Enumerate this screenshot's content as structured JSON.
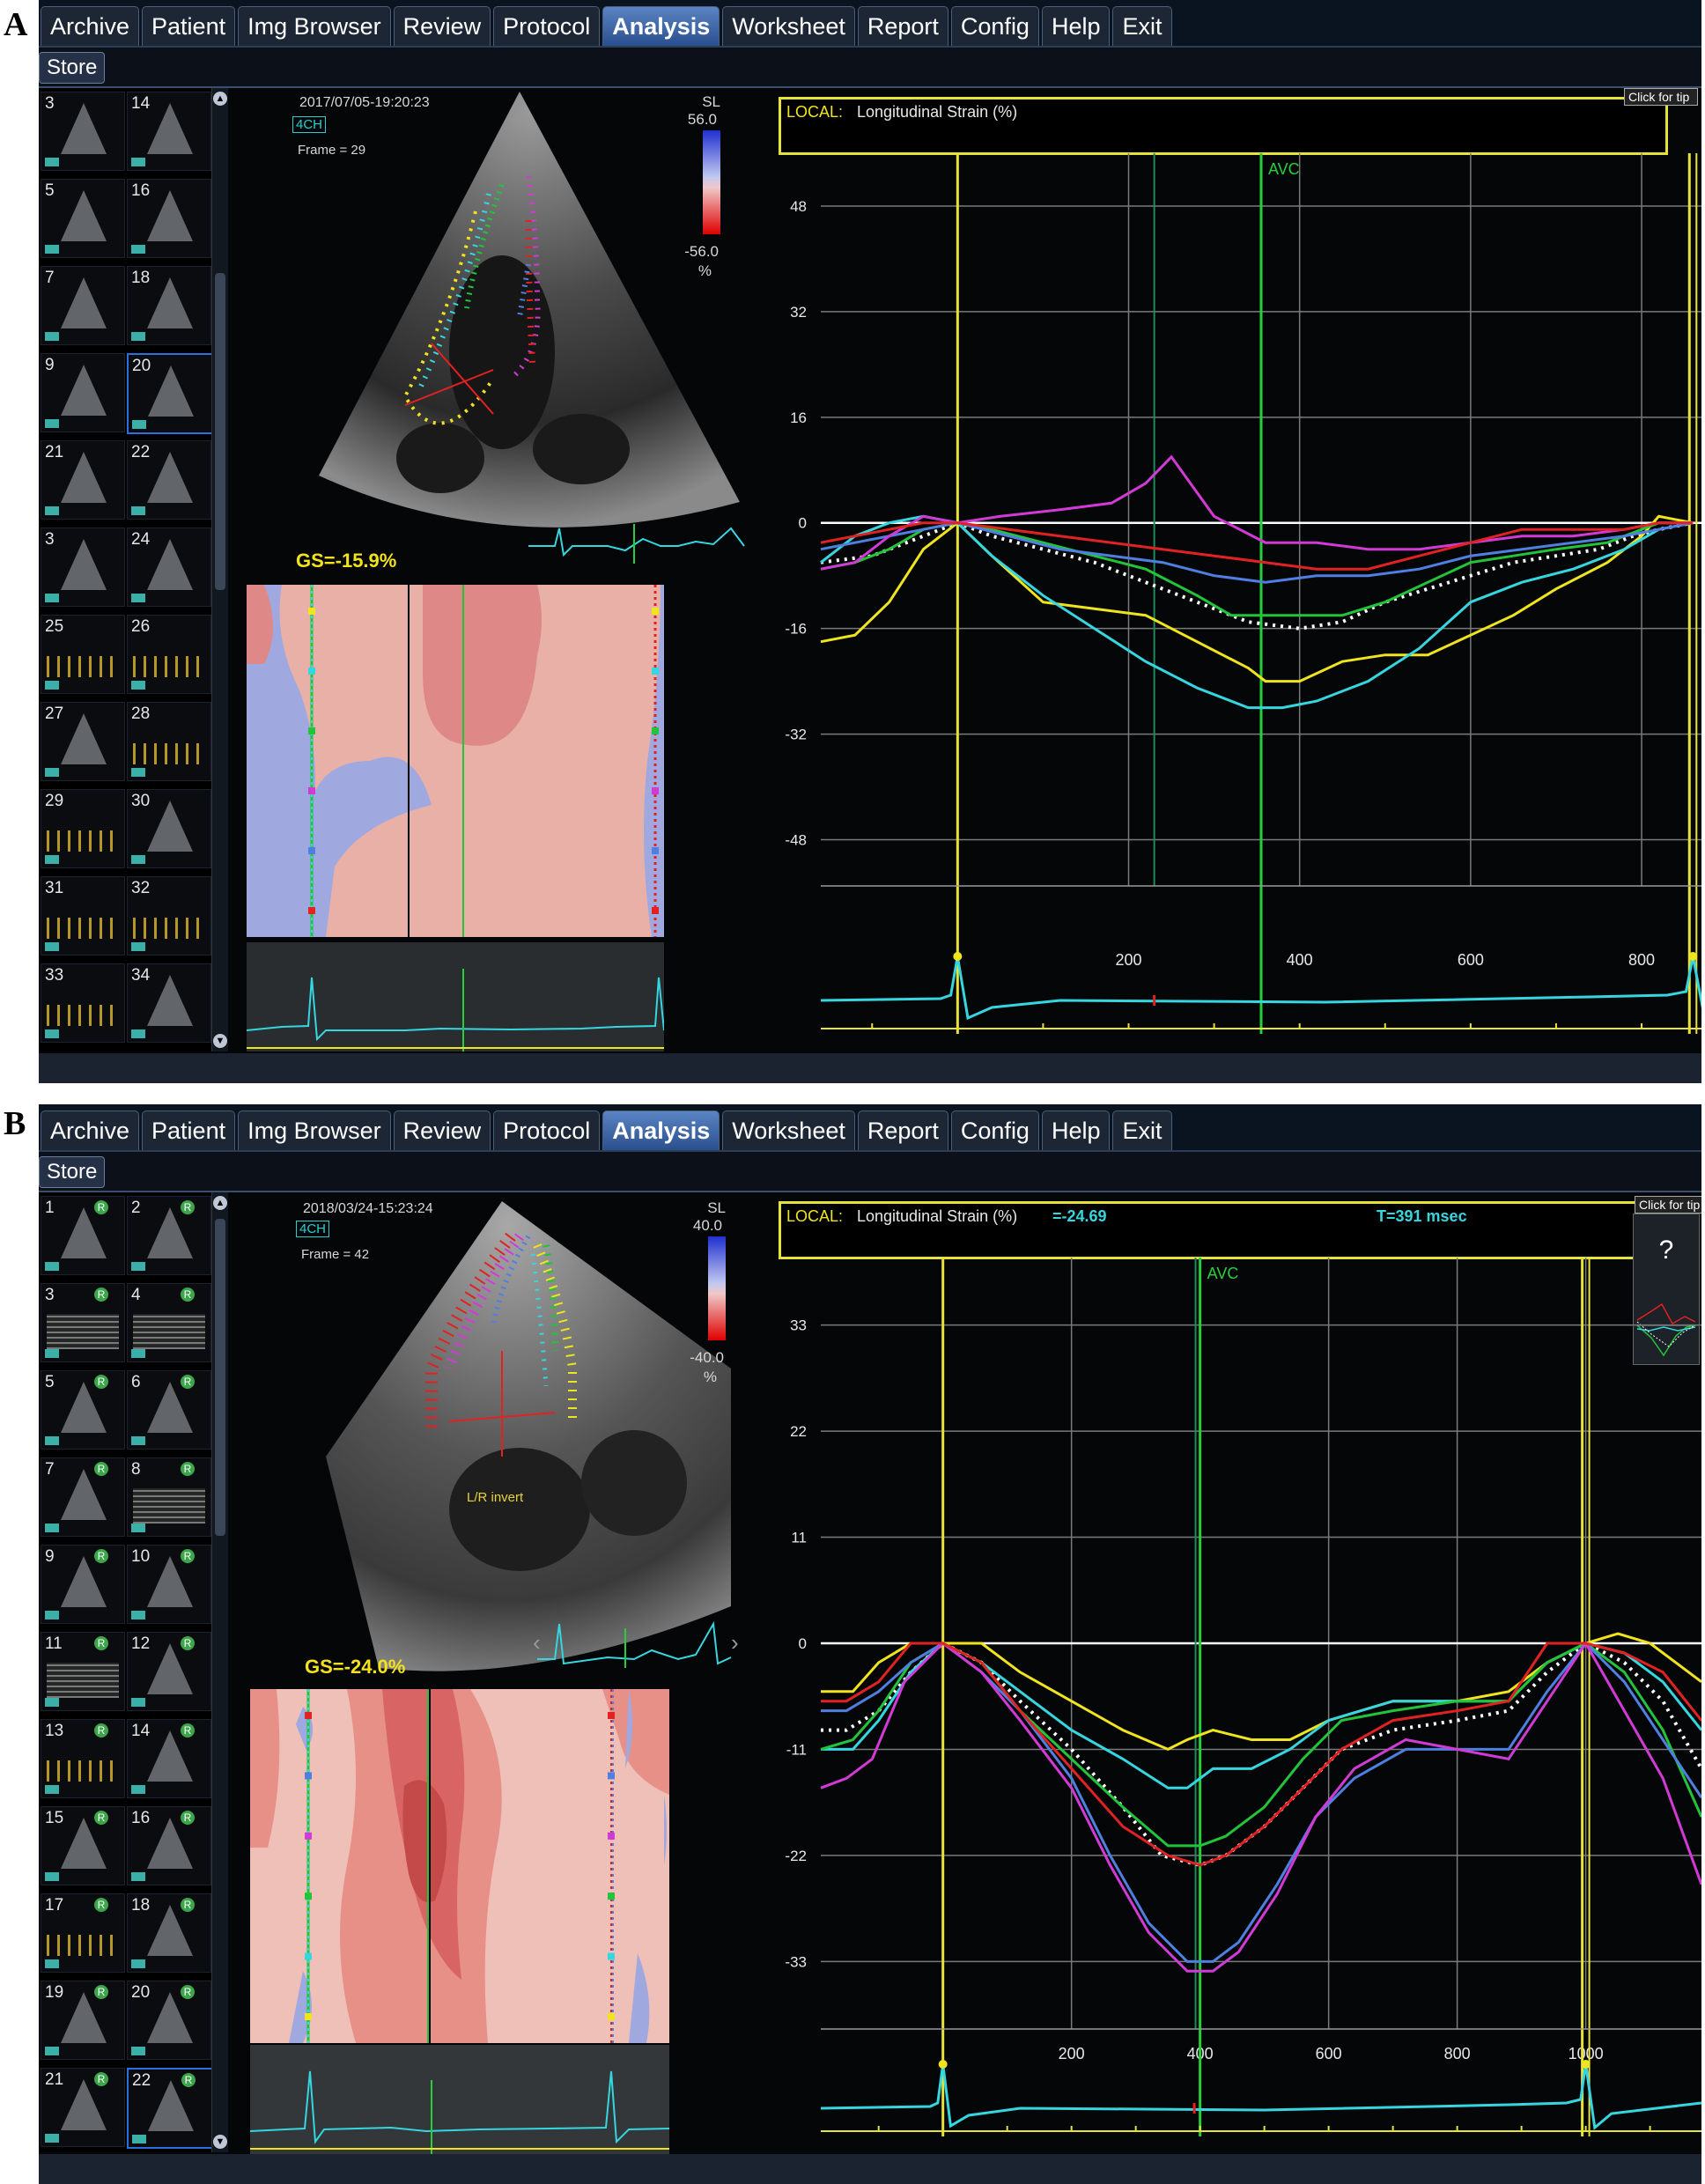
{
  "figure": {
    "panel_a_label": "A",
    "panel_b_label": "B"
  },
  "menu": {
    "items": [
      "Archive",
      "Patient",
      "Img Browser",
      "Review",
      "Protocol",
      "Analysis",
      "Worksheet",
      "Report",
      "Config",
      "Help",
      "Exit"
    ],
    "active": "Analysis",
    "store_label": "Store"
  },
  "colors": {
    "accent_yellow": "#e6e23a",
    "trace_cyan": "#35d6e0",
    "avc_green": "#25d03c",
    "segment_colors": [
      "#ffffff",
      "#f0e41e",
      "#35d6e0",
      "#22c43a",
      "#4f7fe0",
      "#d23ad6",
      "#e02222"
    ]
  },
  "panel_a": {
    "thumbnails": [
      "3",
      "14",
      "5",
      "16",
      "7",
      "18",
      "9",
      "20",
      "21",
      "22",
      "3",
      "24",
      "25",
      "26",
      "27",
      "28",
      "29",
      "30",
      "31",
      "32",
      "33",
      "34"
    ],
    "selected_thumbnail": "20",
    "echo": {
      "timestamp": "2017/07/05-19:20:23",
      "view": "4CH",
      "frame": "Frame = 29",
      "scale_title": "SL",
      "scale_max": "56.0",
      "scale_min": "-56.0",
      "scale_unit": "%",
      "gs": "GS=-15.9%"
    },
    "chart": {
      "local_label": "LOCAL:",
      "title": "Longitudinal Strain (%)",
      "button": "Click for tip",
      "avc_label": "AVC"
    }
  },
  "panel_b": {
    "thumbnails": [
      "1",
      "2",
      "3",
      "4",
      "5",
      "6",
      "7",
      "8",
      "9",
      "10",
      "11",
      "12",
      "13",
      "14",
      "15",
      "16",
      "17",
      "18",
      "19",
      "20",
      "21",
      "22"
    ],
    "selected_thumbnail": "22",
    "echo": {
      "timestamp": "2018/03/24-15:23:24",
      "view": "4CH",
      "frame": "Frame = 42",
      "scale_title": "SL",
      "scale_max": "40.0",
      "scale_min": "-40.0",
      "scale_unit": "%",
      "gs": "GS=-24.0%",
      "lr_invert": "L/R invert"
    },
    "chart": {
      "local_label": "LOCAL:",
      "title": "Longitudinal Strain (%)",
      "value": "=-24.69",
      "time": "T=391 msec",
      "button": "Click for tip",
      "inset_symbol": "?",
      "avc_label": "AVC"
    }
  },
  "chart_data": [
    {
      "type": "line",
      "title": "Longitudinal Strain (%)",
      "xlabel": "",
      "ylabel": "",
      "x_ticks": [
        200,
        400,
        600,
        800
      ],
      "y_ticks": [
        48,
        32,
        16,
        0,
        -16,
        -32,
        -48
      ],
      "xlim": [
        -160,
        870
      ],
      "ylim": [
        -55,
        56
      ],
      "grid": true,
      "markers": {
        "start_ms": 0,
        "end_ms": 860,
        "avc_ms": 355
      },
      "series": [
        {
          "color": "#ffffff",
          "style": "dotted",
          "x": [
            -160,
            -100,
            -60,
            -20,
            0,
            40,
            100,
            160,
            220,
            280,
            340,
            400,
            450,
            500,
            550,
            600,
            650,
            700,
            750,
            790,
            820,
            860
          ],
          "y": [
            -6,
            -5,
            -3,
            -1,
            0,
            -2,
            -4,
            -6,
            -9,
            -12,
            -15,
            -16,
            -15,
            -12,
            -10,
            -8,
            -6,
            -5,
            -4,
            -2,
            -1,
            0
          ]
        },
        {
          "color": "#f0e41e",
          "x": [
            -160,
            -120,
            -80,
            -40,
            0,
            40,
            100,
            160,
            220,
            280,
            340,
            360,
            400,
            450,
            500,
            550,
            600,
            650,
            700,
            760,
            800,
            820,
            860
          ],
          "y": [
            -18,
            -17,
            -12,
            -4,
            0,
            -5,
            -12,
            -13,
            -14,
            -18,
            -22,
            -24,
            -24,
            -21,
            -20,
            -20,
            -17,
            -14,
            -10,
            -6,
            -2,
            1,
            0
          ]
        },
        {
          "color": "#35d6e0",
          "x": [
            -160,
            -120,
            -80,
            -40,
            0,
            40,
            100,
            160,
            220,
            280,
            340,
            380,
            420,
            480,
            540,
            600,
            660,
            720,
            780,
            820,
            860
          ],
          "y": [
            -6,
            -2,
            0,
            1,
            0,
            -5,
            -11,
            -16,
            -21,
            -25,
            -28,
            -28,
            -27,
            -24,
            -19,
            -12,
            -9,
            -7,
            -4,
            -1,
            0
          ]
        },
        {
          "color": "#22c43a",
          "x": [
            -160,
            -120,
            -80,
            -40,
            0,
            40,
            100,
            160,
            220,
            280,
            320,
            360,
            400,
            450,
            500,
            550,
            600,
            650,
            700,
            760,
            800,
            820,
            860
          ],
          "y": [
            -7,
            -6,
            -4,
            -1,
            0,
            -1,
            -3,
            -5,
            -7,
            -11,
            -14,
            -14,
            -14,
            -14,
            -12,
            -9,
            -6,
            -5,
            -4,
            -3,
            -1,
            0,
            0
          ]
        },
        {
          "color": "#4f7fe0",
          "x": [
            -160,
            -120,
            -80,
            -40,
            0,
            60,
            120,
            180,
            240,
            300,
            360,
            420,
            480,
            540,
            600,
            660,
            720,
            780,
            820,
            860
          ],
          "y": [
            -4,
            -3,
            -2,
            -1,
            0,
            -2,
            -4,
            -5,
            -6,
            -8,
            -9,
            -8,
            -8,
            -7,
            -5,
            -4,
            -3,
            -2,
            -1,
            0
          ]
        },
        {
          "color": "#d23ad6",
          "x": [
            -160,
            -120,
            -80,
            -40,
            0,
            50,
            120,
            180,
            220,
            250,
            300,
            360,
            420,
            480,
            540,
            600,
            660,
            720,
            780,
            820,
            860
          ],
          "y": [
            -7,
            -6,
            -2,
            1,
            0,
            1,
            2,
            3,
            6,
            10,
            1,
            -3,
            -3,
            -4,
            -4,
            -3,
            -2,
            -2,
            -1,
            0,
            0
          ]
        },
        {
          "color": "#e02222",
          "x": [
            -160,
            -120,
            -80,
            -40,
            0,
            60,
            120,
            180,
            240,
            300,
            360,
            420,
            480,
            540,
            600,
            660,
            720,
            780,
            820,
            860
          ],
          "y": [
            -3,
            -2,
            -1,
            0,
            0,
            -1,
            -2,
            -3,
            -4,
            -5,
            -6,
            -7,
            -7,
            -5,
            -3,
            -1,
            -1,
            -1,
            0,
            0
          ]
        }
      ]
    },
    {
      "type": "line",
      "title": "Longitudinal Strain (%) =-24.69",
      "xlabel": "",
      "ylabel": "",
      "x_ticks": [
        200,
        400,
        600,
        800,
        1000
      ],
      "y_ticks": [
        33,
        22,
        11,
        0,
        -11,
        -22,
        -33
      ],
      "xlim": [
        -190,
        1180
      ],
      "ylim": [
        -40,
        40
      ],
      "grid": true,
      "markers": {
        "start_ms": 0,
        "end_ms": 1000,
        "avc_ms": 400
      },
      "series": [
        {
          "color": "#ffffff",
          "style": "dotted",
          "x": [
            -190,
            -150,
            -100,
            -50,
            0,
            60,
            120,
            200,
            280,
            340,
            400,
            440,
            500,
            560,
            620,
            700,
            800,
            880,
            940,
            1000,
            1060,
            1120,
            1180
          ],
          "y": [
            -9,
            -9,
            -7,
            -3,
            0,
            -2,
            -6,
            -11,
            -17,
            -22,
            -23,
            -22,
            -19,
            -15,
            -11,
            -9,
            -8,
            -7,
            -3,
            0,
            -2,
            -6,
            -13
          ]
        },
        {
          "color": "#f0e41e",
          "x": [
            -190,
            -140,
            -100,
            -50,
            0,
            60,
            120,
            200,
            280,
            350,
            380,
            420,
            480,
            540,
            600,
            700,
            800,
            880,
            940,
            1000,
            1050,
            1100,
            1180
          ],
          "y": [
            -5,
            -5,
            -2,
            0,
            0,
            0,
            -3,
            -6,
            -9,
            -11,
            -10,
            -9,
            -10,
            -10,
            -8,
            -6,
            -6,
            -5,
            -2,
            0,
            1,
            0,
            -4
          ]
        },
        {
          "color": "#35d6e0",
          "x": [
            -190,
            -140,
            -100,
            -50,
            0,
            60,
            120,
            200,
            280,
            350,
            380,
            420,
            480,
            540,
            600,
            700,
            800,
            880,
            940,
            1000,
            1060,
            1120,
            1180
          ],
          "y": [
            -11,
            -11,
            -8,
            -3,
            0,
            -2,
            -5,
            -9,
            -12,
            -15,
            -15,
            -13,
            -13,
            -11,
            -8,
            -6,
            -6,
            -6,
            -2,
            0,
            -1,
            -4,
            -9
          ]
        },
        {
          "color": "#22c43a",
          "x": [
            -190,
            -140,
            -100,
            -50,
            0,
            60,
            120,
            200,
            280,
            350,
            400,
            440,
            500,
            560,
            620,
            700,
            800,
            880,
            940,
            1000,
            1060,
            1120,
            1180
          ],
          "y": [
            -11,
            -10,
            -7,
            -2,
            0,
            -2,
            -7,
            -12,
            -17,
            -21,
            -21,
            -20,
            -17,
            -12,
            -8,
            -7,
            -6,
            -6,
            -2,
            0,
            -3,
            -9,
            -18
          ]
        },
        {
          "color": "#4f7fe0",
          "x": [
            -190,
            -150,
            -100,
            -50,
            0,
            60,
            120,
            200,
            260,
            320,
            380,
            420,
            460,
            520,
            580,
            640,
            720,
            800,
            880,
            940,
            1000,
            1060,
            1120,
            1180
          ],
          "y": [
            -7,
            -7,
            -5,
            -2,
            0,
            -3,
            -7,
            -14,
            -22,
            -29,
            -33,
            -33,
            -31,
            -25,
            -18,
            -14,
            -11,
            -11,
            -11,
            -5,
            0,
            -4,
            -10,
            -16
          ]
        },
        {
          "color": "#d23ad6",
          "x": [
            -190,
            -150,
            -110,
            -60,
            0,
            60,
            120,
            200,
            260,
            320,
            380,
            420,
            460,
            520,
            580,
            640,
            720,
            800,
            880,
            940,
            1000,
            1060,
            1120,
            1180
          ],
          "y": [
            -15,
            -14,
            -12,
            -4,
            0,
            -3,
            -8,
            -15,
            -23,
            -30,
            -34,
            -34,
            -32,
            -26,
            -18,
            -13,
            -10,
            -11,
            -12,
            -6,
            0,
            -7,
            -14,
            -25
          ]
        },
        {
          "color": "#e02222",
          "x": [
            -190,
            -150,
            -100,
            -50,
            0,
            60,
            120,
            200,
            280,
            350,
            400,
            440,
            500,
            560,
            620,
            700,
            800,
            880,
            940,
            1000,
            1060,
            1120,
            1180
          ],
          "y": [
            -6,
            -6,
            -4,
            0,
            0,
            -2,
            -7,
            -13,
            -19,
            -22,
            -23,
            -22,
            -19,
            -15,
            -11,
            -8,
            -7,
            -6,
            0,
            0,
            -1,
            -3,
            -8
          ]
        }
      ]
    }
  ]
}
